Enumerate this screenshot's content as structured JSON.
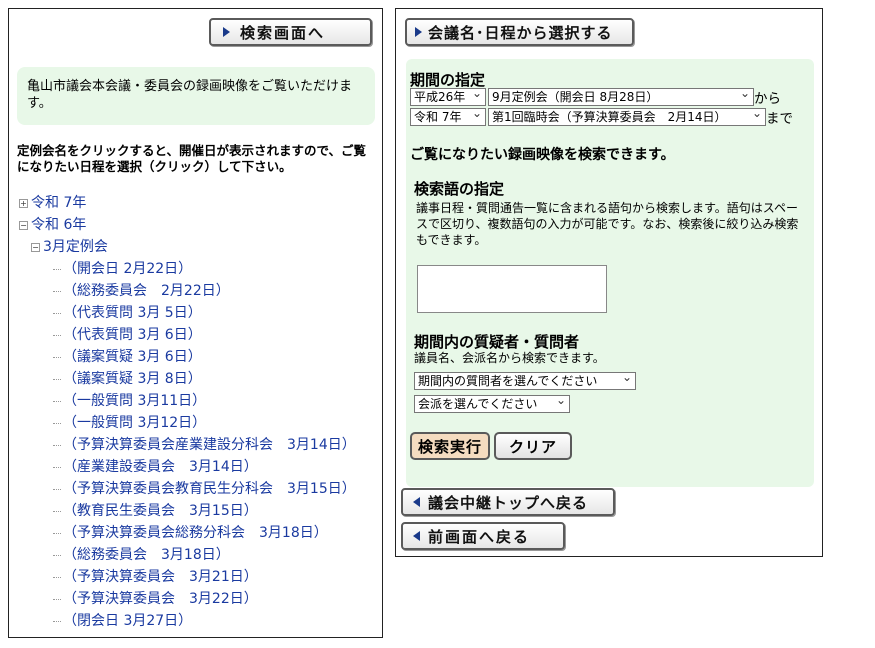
{
  "left": {
    "search_button": "検索画面へ",
    "intro": "亀山市議会本会議・委員会の録画映像をご覧いただけます。",
    "instruction": "定例会名をクリックすると、開催日が表示されますので、ご覧になりたい日程を選択（クリック）して下さい。",
    "tree": {
      "year1": "令和 7年",
      "year2": "令和 6年",
      "session": "3月定例会",
      "items": [
        "（開会日 2月22日）",
        "（総務委員会　2月22日）",
        "（代表質問 3月 5日）",
        "（代表質問 3月 6日）",
        "（議案質疑 3月 6日）",
        "（議案質疑 3月 8日）",
        "（一般質問 3月11日）",
        "（一般質問 3月12日）",
        "（予算決算委員会産業建設分科会　3月14日）",
        "（産業建設委員会　3月14日）",
        "（予算決算委員会教育民生分科会　3月15日）",
        "（教育民生委員会　3月15日）",
        "（予算決算委員会総務分科会　3月18日）",
        "（総務委員会　3月18日）",
        "（予算決算委員会　3月21日）",
        "（予算決算委員会　3月22日）",
        "（閉会日 3月27日）"
      ]
    }
  },
  "right": {
    "select_button": "会議名･日程から選択する",
    "period_heading": "期間の指定",
    "from_year": "平成26年",
    "from_session": "9月定例会（開会日 8月28日）",
    "from_suffix": "から",
    "to_year": "令和 7年",
    "to_session": "第1回臨時会（予算決算委員会　2月14日）",
    "to_suffix": "まで",
    "search_note": "ご覧になりたい録画映像を検索できます。",
    "keyword_heading": "検索語の指定",
    "keyword_desc": "議事日程・質問通告一覧に含まれる語句から検索します。語句はスペースで区切り、複数語句の入力が可能です。なお、検索後に絞り込み検索もできます。",
    "keyword_value": "",
    "questioner_heading": "期間内の質疑者・質問者",
    "questioner_desc": "議員名、会派名から検索できます。",
    "questioner_select": "期間内の質問者を選んでください",
    "faction_select": "会派を選んでください",
    "search_exec": "検索実行",
    "clear": "クリア",
    "top_button": "議会中継トップへ戻る",
    "back_button": "前画面へ戻る"
  },
  "colors": {
    "link": "#1a3aa0",
    "panel_green": "#e8f8e8",
    "accent_blue": "#1a3a8a",
    "exec_btn": "#f5dcc0"
  }
}
